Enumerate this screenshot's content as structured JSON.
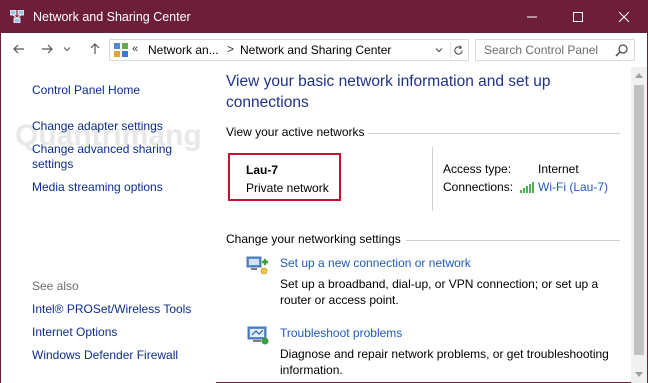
{
  "window": {
    "title": "Network and Sharing Center",
    "accent": "#6d1f3a",
    "minimize_icon": "minimize-icon",
    "maximize_icon": "maximize-icon",
    "close_icon": "close-icon"
  },
  "navigation": {
    "back_icon": "arrow-left-icon",
    "forward_icon": "arrow-right-icon",
    "recent_icon": "chevron-down-icon",
    "up_icon": "arrow-up-icon",
    "address": {
      "overflow": "«",
      "crumbs": [
        "Network an...",
        "Network and Sharing Center"
      ],
      "separator": ">"
    },
    "search": {
      "placeholder": "Search Control Panel"
    }
  },
  "sidebar": {
    "home": "Control Panel Home",
    "links": [
      "Change adapter settings",
      "Change advanced sharing settings",
      "Media streaming options"
    ],
    "see_also_heading": "See also",
    "see_also": [
      "Intel® PROSet/Wireless Tools",
      "Internet Options",
      "Windows Defender Firewall"
    ],
    "watermark": "Quantrimang"
  },
  "main": {
    "title": "View your basic network information and set up connections",
    "active_networks_heading": "View your active networks",
    "network": {
      "name": "Lau-7",
      "type": "Private network",
      "access_type_label": "Access type:",
      "access_type_value": "Internet",
      "connections_label": "Connections:",
      "connections_value": "Wi-Fi (Lau-7)"
    },
    "change_settings_heading": "Change your networking settings",
    "tasks": [
      {
        "title": "Set up a new connection or network",
        "description": "Set up a broadband, dial-up, or VPN connection; or set up a router or access point.",
        "icon": "new-connection-icon"
      },
      {
        "title": "Troubleshoot problems",
        "description": "Diagnose and repair network problems, or get troubleshooting information.",
        "icon": "troubleshoot-icon"
      }
    ]
  },
  "colors": {
    "link": "#1e5bb8",
    "title_blue": "#1e3287",
    "highlight_red": "#c8102e"
  }
}
